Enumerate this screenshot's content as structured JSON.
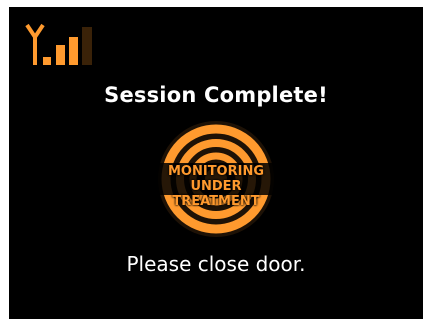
{
  "status": {
    "title": "Session Complete!",
    "message": "Please close door."
  },
  "emblem": {
    "line1": "MONITORING",
    "line2": "UNDER TREATMENT",
    "icon": "treatment-rings-icon"
  },
  "signal": {
    "icon": "signal-strength-icon",
    "level": 0.67
  },
  "colors": {
    "accent": "#ff9a2e",
    "ring_dark": "#8a4a08",
    "background": "#000000",
    "text": "#ffffff"
  }
}
